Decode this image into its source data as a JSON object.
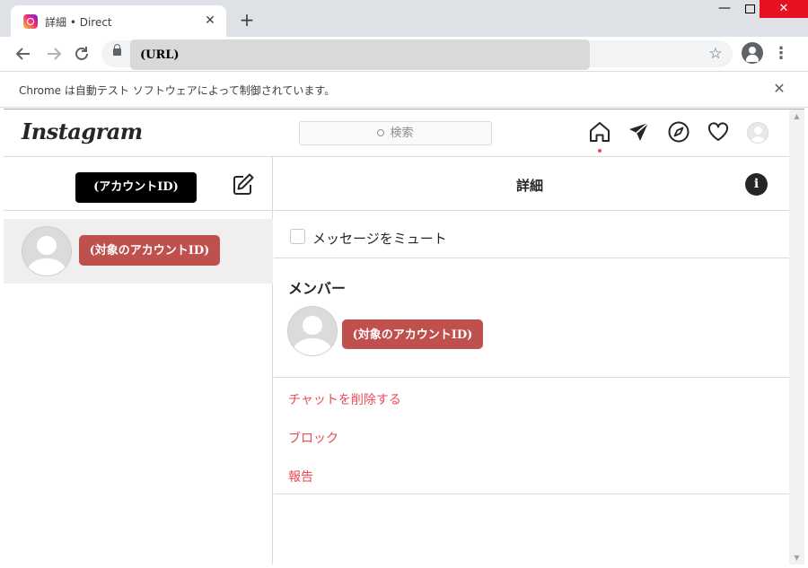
{
  "browser": {
    "tab_title": "詳細 • Direct",
    "tab_close": "✕",
    "new_tab": "+",
    "window_minimize": "—",
    "window_close": "✕",
    "url": "(URL)",
    "infobar_text": "Chrome は自動テスト ソフトウェアによって制御されています。",
    "infobar_close": "✕"
  },
  "header": {
    "logo": "Instagram",
    "search_placeholder": "検索"
  },
  "left_panel": {
    "account_id": "(アカウントID)",
    "thread": {
      "name": "(対象のアカウントID)"
    }
  },
  "details": {
    "title": "詳細",
    "info_icon": "i",
    "mute_label": "メッセージをミュート",
    "mute_checked": false,
    "members_title": "メンバー",
    "members": [
      {
        "name": "(対象のアカウントID)"
      }
    ],
    "actions": [
      "チャットを削除する",
      "ブロック",
      "報告"
    ]
  },
  "colors": {
    "danger": "#ed4956",
    "redaction": "#c0504d",
    "border": "#dbdbdb",
    "text": "#262626"
  }
}
